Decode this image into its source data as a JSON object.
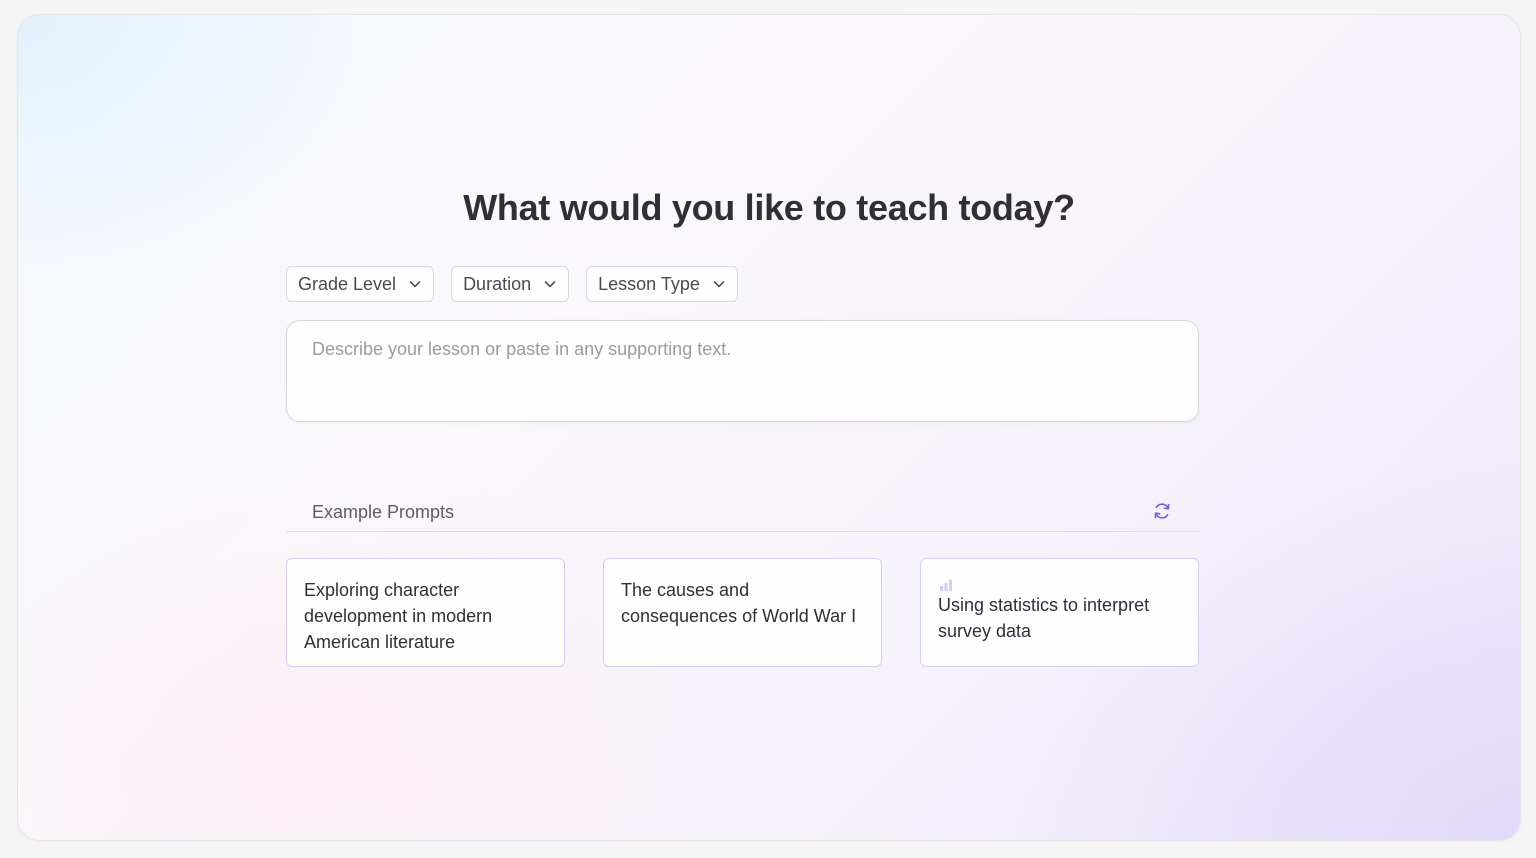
{
  "heading": "What would you like to teach today?",
  "filters": [
    {
      "label": "Grade Level"
    },
    {
      "label": "Duration"
    },
    {
      "label": "Lesson Type"
    }
  ],
  "prompt": {
    "placeholder": "Describe your lesson or paste in any supporting text.",
    "value": ""
  },
  "examples": {
    "title": "Example Prompts",
    "refresh_icon": "refresh-icon",
    "cards": [
      {
        "text": "Exploring character development in modern American literature"
      },
      {
        "text": "The causes and consequences of World War I"
      },
      {
        "text": "Using statistics to interpret survey data",
        "icon": "bar-chart-icon"
      }
    ]
  },
  "colors": {
    "accent": "#7c5cd6",
    "card_border": "#d8cdf2",
    "heading": "#2f2f35"
  }
}
